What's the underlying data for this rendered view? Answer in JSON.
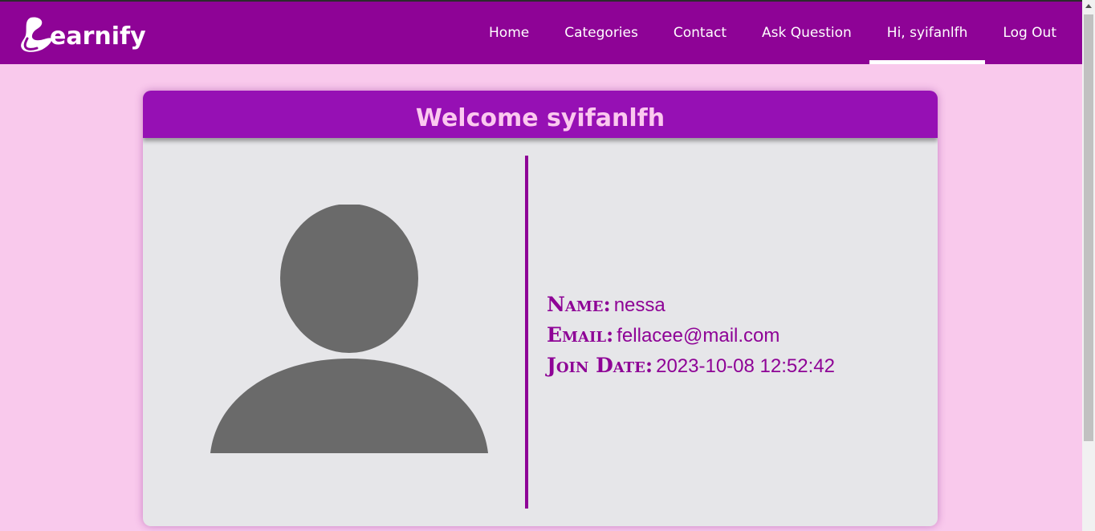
{
  "brand": {
    "name": "earnify",
    "color": "#8e0396"
  },
  "nav": {
    "items": [
      {
        "label": "Home",
        "active": false
      },
      {
        "label": "Categories",
        "active": false
      },
      {
        "label": "Contact",
        "active": false
      },
      {
        "label": "Ask Question",
        "active": false
      },
      {
        "label": "Hi, syifanlfh",
        "active": true
      },
      {
        "label": "Log Out",
        "active": false
      }
    ]
  },
  "profile": {
    "title": "Welcome syifanlfh",
    "avatar_icon": "user-silhouette-icon",
    "fields": [
      {
        "label": "Name:",
        "value": "nessa"
      },
      {
        "label": "Email:",
        "value": "fellacee@mail.com"
      },
      {
        "label": "Join Date:",
        "value": "2023-10-08 12:52:42"
      }
    ]
  },
  "colors": {
    "page_bg": "#f9c9ec",
    "header_bg": "#9610b4",
    "card_bg": "#e6e6e9",
    "title_text": "#fbc8ef",
    "avatar": "#6a6a6a"
  }
}
